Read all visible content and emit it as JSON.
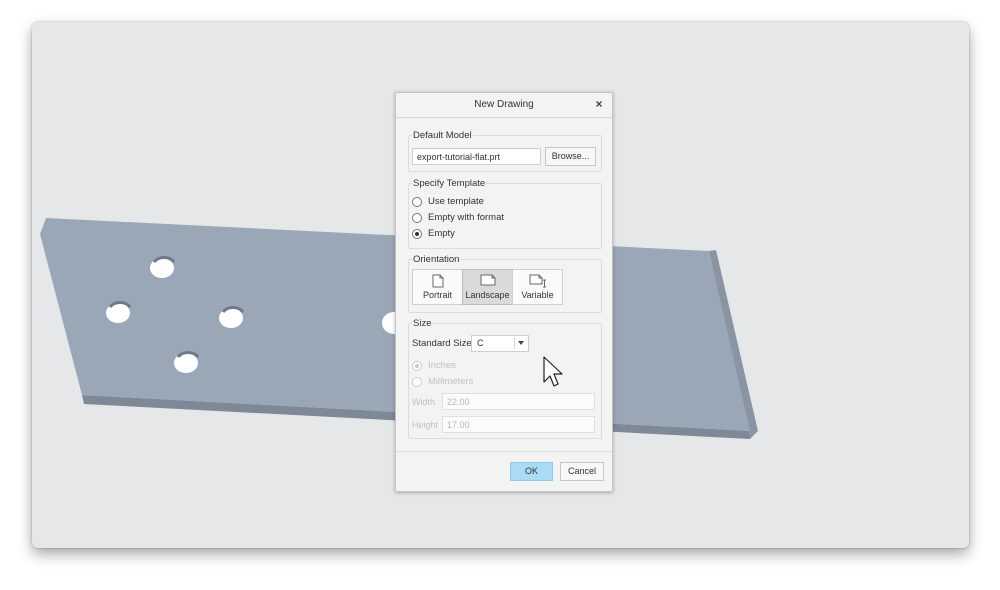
{
  "dialog": {
    "title": "New Drawing",
    "close_glyph": "×"
  },
  "default_model": {
    "label": "Default Model",
    "value": "export-tutorial-flat.prt",
    "browse_label": "Browse..."
  },
  "template": {
    "label": "Specify Template",
    "options": [
      "Use template",
      "Empty with format",
      "Empty"
    ],
    "selected": "Empty"
  },
  "orientation": {
    "label": "Orientation",
    "options": [
      "Portrait",
      "Landscape",
      "Variable"
    ],
    "selected": "Landscape"
  },
  "size": {
    "label": "Size",
    "standard_size_label": "Standard Size",
    "standard_size_value": "C",
    "units": [
      "Inches",
      "Millimeters"
    ],
    "selected_unit": "Inches",
    "width_label": "Width",
    "width_value": "22.00",
    "height_label": "Height",
    "height_value": "17.00"
  },
  "buttons": {
    "ok": "OK",
    "cancel": "Cancel"
  },
  "colors": {
    "viewport_bg": "#e6e7e8",
    "plate": "#9aa7b7",
    "ok_button": "#a9dcf4"
  }
}
